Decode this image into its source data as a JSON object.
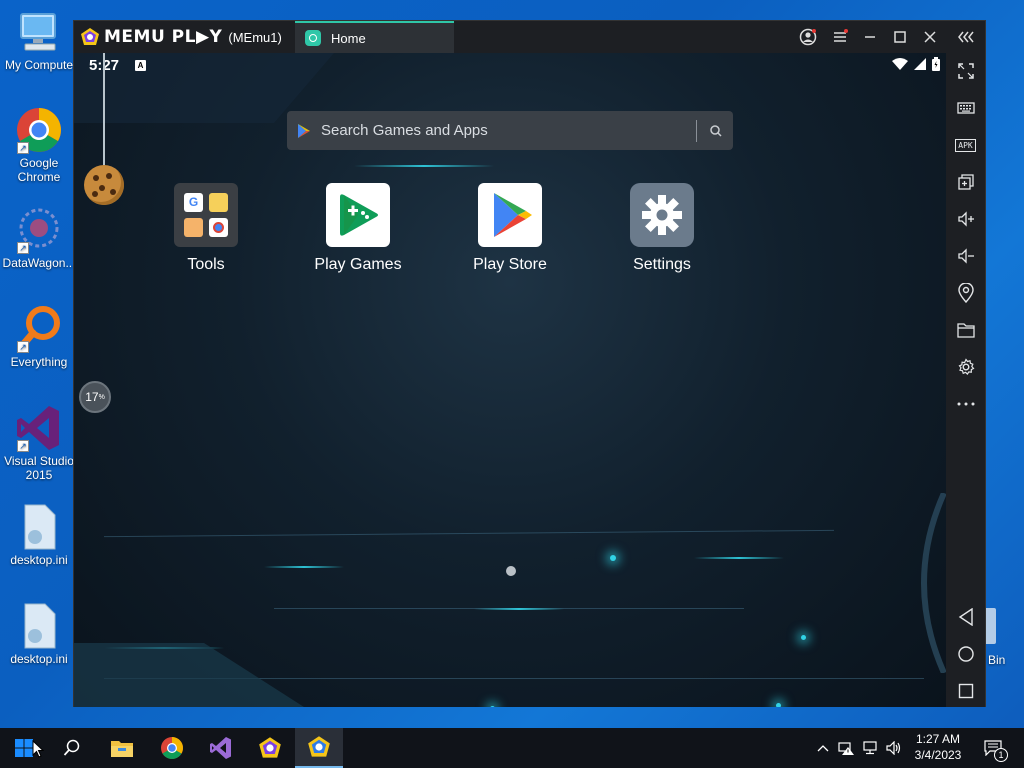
{
  "desktop": {
    "icons": [
      {
        "label": "My Compute"
      },
      {
        "label": "Google Chrome"
      },
      {
        "label": "DataWagon..."
      },
      {
        "label": "Everything"
      },
      {
        "label": "Visual Studio 2015"
      },
      {
        "label": "desktop.ini"
      },
      {
        "label": "desktop.ini"
      }
    ],
    "recycle_bin_label": "Bin"
  },
  "memu": {
    "brand": "MEMU PL▶Y",
    "instance": "(MEmu1)",
    "tab_label": "Home",
    "accent_color": "#2fc7a8",
    "status": {
      "time": "5:27",
      "notification_icon": "A"
    },
    "search": {
      "placeholder": "Search Games and Apps"
    },
    "apps": [
      {
        "label": "Tools"
      },
      {
        "label": "Play Games"
      },
      {
        "label": "Play Store"
      },
      {
        "label": "Settings"
      }
    ],
    "overlay_progress": {
      "value": "17",
      "unit": "%"
    },
    "sidebar_buttons": [
      "fullscreen-icon",
      "keyboard-icon",
      "apk-icon",
      "multi-window-icon",
      "volume-up-icon",
      "volume-down-icon",
      "location-icon",
      "folder-icon",
      "settings-icon",
      "more-icon",
      "back-icon",
      "home-icon",
      "recents-icon"
    ],
    "sidebar_apk_text": "APK"
  },
  "taskbar": {
    "clock_time": "1:27 AM",
    "clock_date": "3/4/2023",
    "notification_count": "1"
  }
}
